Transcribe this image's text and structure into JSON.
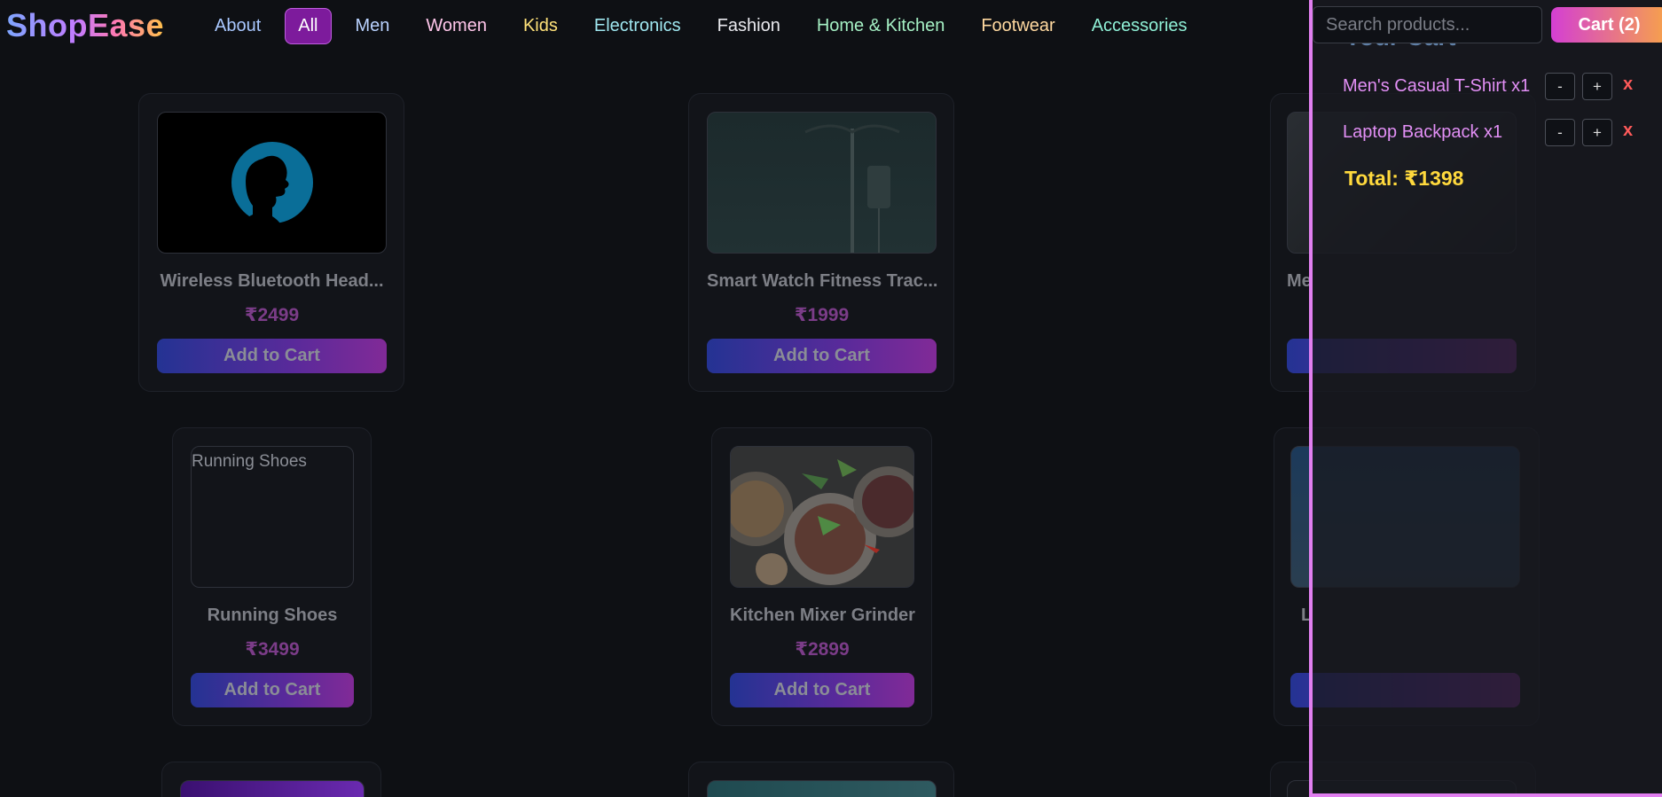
{
  "brand": {
    "name": "ShopEase"
  },
  "nav": {
    "items": [
      {
        "label": "About",
        "color": "#a9c8ff"
      },
      {
        "label": "All",
        "color": "#ffffff"
      },
      {
        "label": "Men",
        "color": "#b9d2ff"
      },
      {
        "label": "Women",
        "color": "#ffc6ea"
      },
      {
        "label": "Kids",
        "color": "#ffe27a"
      },
      {
        "label": "Electronics",
        "color": "#9fe7f0"
      },
      {
        "label": "Fashion",
        "color": "#e9e9ee"
      },
      {
        "label": "Home & Kitchen",
        "color": "#a5f0c4"
      },
      {
        "label": "Footwear",
        "color": "#ffd9a0"
      },
      {
        "label": "Accessories",
        "color": "#8ff0d6"
      }
    ],
    "active": "All"
  },
  "search": {
    "placeholder": "Search products..."
  },
  "cart_button": {
    "label": "Cart (2)"
  },
  "products": [
    {
      "name": "Wireless Bluetooth Head...",
      "price": "₹2499",
      "button": "Add to Cart"
    },
    {
      "name": "Smart Watch Fitness Trac...",
      "price": "₹1999",
      "button": "Add to Cart"
    },
    {
      "name": "Me",
      "button": ""
    },
    {
      "name": "Running Shoes",
      "price": "₹3499",
      "button": "Add to Cart",
      "image_alt": "Running Shoes"
    },
    {
      "name": "Kitchen Mixer Grinder",
      "price": "₹2899",
      "button": "Add to Cart"
    },
    {
      "name": "L",
      "button": ""
    }
  ],
  "cart": {
    "title": "Your Cart",
    "items": [
      {
        "label": "Men's Casual T-Shirt x1",
        "minus": "-",
        "plus": "+",
        "remove": "x"
      },
      {
        "label": "Laptop Backpack x1",
        "minus": "-",
        "plus": "+",
        "remove": "x"
      }
    ],
    "total": "Total: ₹1398"
  },
  "colors": {
    "accent": "#7d1b9c",
    "panel_border": "#e17ff0",
    "total": "#ffd93d",
    "price": "#7b3c88"
  }
}
